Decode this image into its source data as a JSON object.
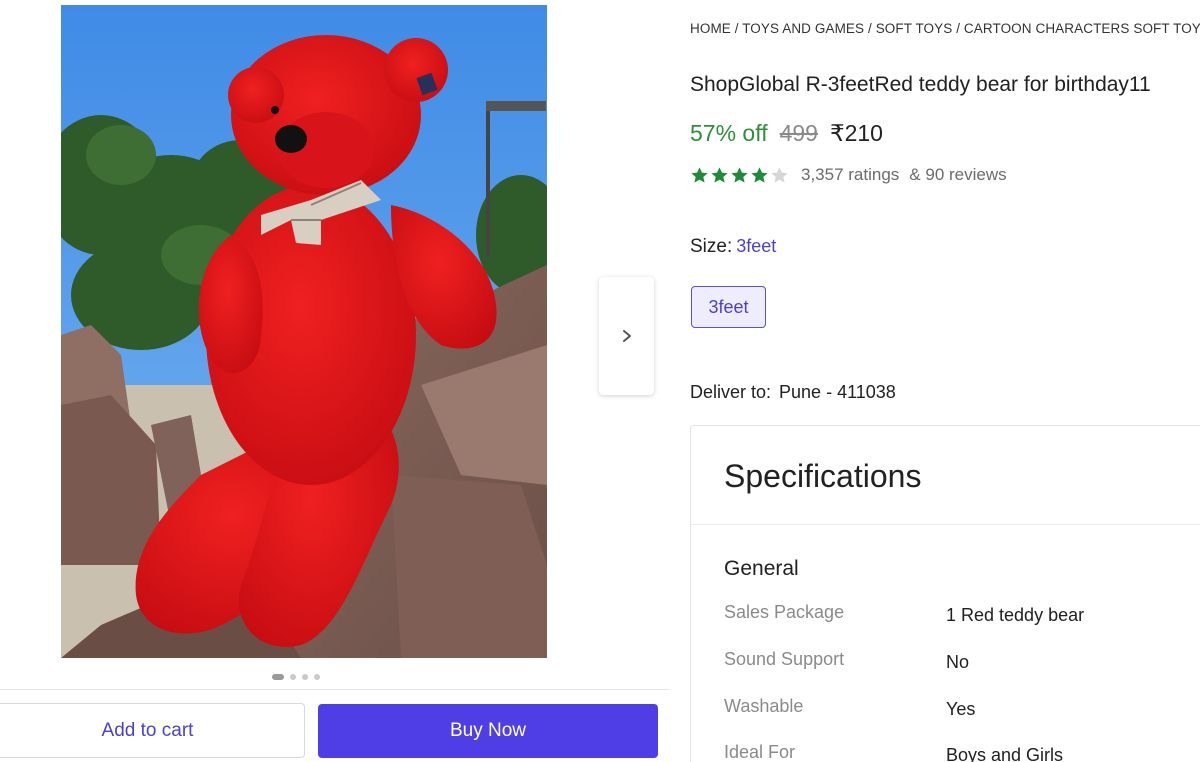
{
  "breadcrumb": "HOME / TOYS AND GAMES / SOFT TOYS / CARTOON CHARACTERS SOFT TOYS",
  "product": {
    "title": "ShopGlobal R-3feetRed teddy bear for birthday11",
    "discount": "57% off",
    "mrp": "499",
    "price": "₹210",
    "rating_value": 4,
    "ratings_text": "3,357 ratings",
    "reviews_text": "& 90 reviews"
  },
  "size": {
    "label": "Size:",
    "selected": "3feet",
    "options": [
      "3feet"
    ]
  },
  "delivery": {
    "label": "Deliver to:",
    "location": "Pune - 411038"
  },
  "carousel": {
    "dot_count": 4,
    "active_index": 0
  },
  "actions": {
    "add_to_cart": "Add to cart",
    "buy_now": "Buy Now"
  },
  "specifications": {
    "title": "Specifications",
    "group": "General",
    "rows": [
      {
        "key": "Sales Package",
        "value": "1 Red teddy bear"
      },
      {
        "key": "Sound Support",
        "value": "No"
      },
      {
        "key": "Washable",
        "value": "Yes"
      },
      {
        "key": "Ideal For",
        "value": "Boys and Girls"
      }
    ]
  },
  "colors": {
    "accent": "#4f3ee5",
    "discount_green": "#2e8f3a",
    "star_green": "#1f8b3a"
  },
  "icons": {
    "next": "chevron-right-icon",
    "star": "star-icon"
  }
}
